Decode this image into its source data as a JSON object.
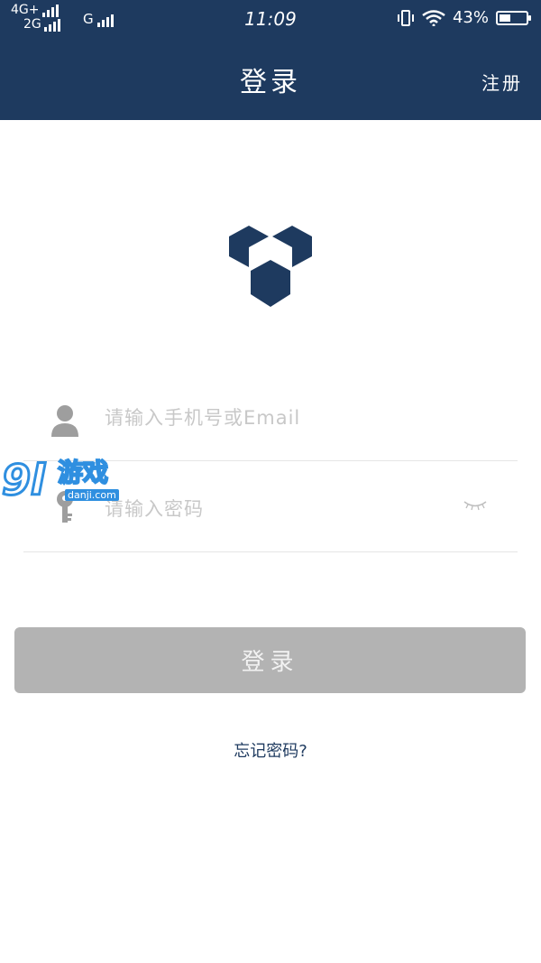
{
  "status_bar": {
    "network_primary": "4G+",
    "network_secondary": "2G",
    "network_third": "G",
    "time": "11:09",
    "battery": "43%",
    "battery_level": 0.43
  },
  "header": {
    "title": "登录",
    "register_label": "注册"
  },
  "form": {
    "username_placeholder": "请输入手机号或Email",
    "password_placeholder": "请输入密码"
  },
  "actions": {
    "login_label": "登录",
    "forgot_label": "忘记密码?"
  },
  "watermark": {
    "number": "9l",
    "brand": "游戏",
    "domain": "danji.com"
  },
  "colors": {
    "header_bg": "#1e3a5f",
    "button_bg": "#b3b3b3",
    "watermark": "#2f8fe0"
  }
}
